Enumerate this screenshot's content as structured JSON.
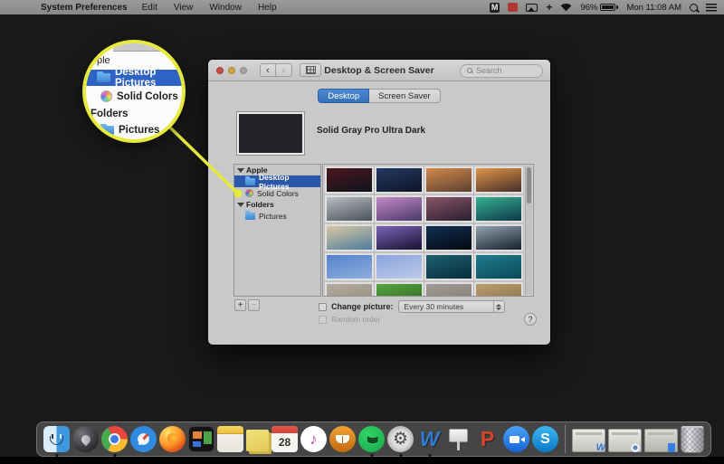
{
  "menu_bar": {
    "menus": [
      "System Preferences",
      "Edit",
      "View",
      "Window",
      "Help"
    ],
    "status": {
      "battery_percent": "96%",
      "clock": "Mon 11:08 AM"
    }
  },
  "window": {
    "title": "Desktop & Screen Saver",
    "search_placeholder": "Search",
    "tabs": [
      {
        "label": "Desktop",
        "active": true
      },
      {
        "label": "Screen Saver",
        "active": false
      }
    ],
    "preview_label": "Solid Gray Pro Ultra Dark",
    "sidebar": {
      "groups": [
        {
          "label": "Apple",
          "items": [
            {
              "label": "Desktop Pictures",
              "icon": "folder-icon",
              "selected": true
            },
            {
              "label": "Solid Colors",
              "icon": "color-wheel-icon",
              "selected": false
            }
          ]
        },
        {
          "label": "Folders",
          "items": [
            {
              "label": "Pictures",
              "icon": "folder-icon",
              "selected": false
            }
          ]
        }
      ]
    },
    "change_picture_label": "Change picture:",
    "interval_value": "Every 30 minutes",
    "random_order_label": "Random order",
    "thumbnails": [
      {
        "from": "#4a1620",
        "to": "#10141c"
      },
      {
        "from": "#243a63",
        "to": "#0d1426"
      },
      {
        "from": "#d08a4c",
        "to": "#5d4030"
      },
      {
        "from": "#e0964a",
        "to": "#452e28"
      },
      {
        "from": "#b9bdc3",
        "to": "#4a5159"
      },
      {
        "from": "#c488c8",
        "to": "#4a3a6a"
      },
      {
        "from": "#8a5568",
        "to": "#281e2e"
      },
      {
        "from": "#36b091",
        "to": "#0e3a4a"
      },
      {
        "from": "#d8c7a2",
        "to": "#4f7d9e"
      },
      {
        "from": "#7a64b8",
        "to": "#181230"
      },
      {
        "from": "#123055",
        "to": "#04080f"
      },
      {
        "from": "#93a3b1",
        "to": "#16202c"
      },
      {
        "from": "#5581cd",
        "to": "#8fb0dd"
      },
      {
        "from": "#8aa3dd",
        "to": "#bccbe8"
      },
      {
        "from": "#1d5f70",
        "to": "#082e3d"
      },
      {
        "from": "#1f7e8e",
        "to": "#0a4858"
      },
      {
        "from": "#b5ac9f",
        "to": "#8f887c"
      },
      {
        "from": "#57a33e",
        "to": "#276622"
      },
      {
        "from": "#a09d95",
        "to": "#7d7a72"
      },
      {
        "from": "#b99d6c",
        "to": "#86704a"
      }
    ]
  },
  "callout": {
    "row_apple_partial": "ple",
    "row_selected": "Desktop Pictures",
    "row_solid": "Solid Colors",
    "row_folders": "Folders",
    "row_pictures": "Pictures",
    "accent_color": "#e7e93c",
    "selection_color": "#2e62c4"
  },
  "dock": {
    "items": [
      {
        "type": "finder",
        "running": true
      },
      {
        "type": "launchpad"
      },
      {
        "type": "chrome",
        "running": true
      },
      {
        "type": "safari"
      },
      {
        "type": "firefox"
      },
      {
        "type": "tiles"
      },
      {
        "type": "notes"
      },
      {
        "type": "stickies"
      },
      {
        "type": "calendar",
        "glyph": "28"
      },
      {
        "type": "itunes",
        "glyph": "♪"
      },
      {
        "type": "books"
      },
      {
        "type": "spotify",
        "glyph": ")))",
        "running": true
      },
      {
        "type": "settings",
        "glyph": "⚙",
        "running": true
      },
      {
        "type": "word",
        "glyph": "W",
        "running": true
      },
      {
        "type": "keynote"
      },
      {
        "type": "powerpoint",
        "glyph": "P"
      },
      {
        "type": "facetime"
      },
      {
        "type": "skype",
        "glyph": "S"
      },
      {
        "type": "separator"
      },
      {
        "type": "minwin-word",
        "glyph": "W"
      },
      {
        "type": "minwin-chrome"
      },
      {
        "type": "minwin-doc"
      },
      {
        "type": "trash"
      }
    ]
  }
}
